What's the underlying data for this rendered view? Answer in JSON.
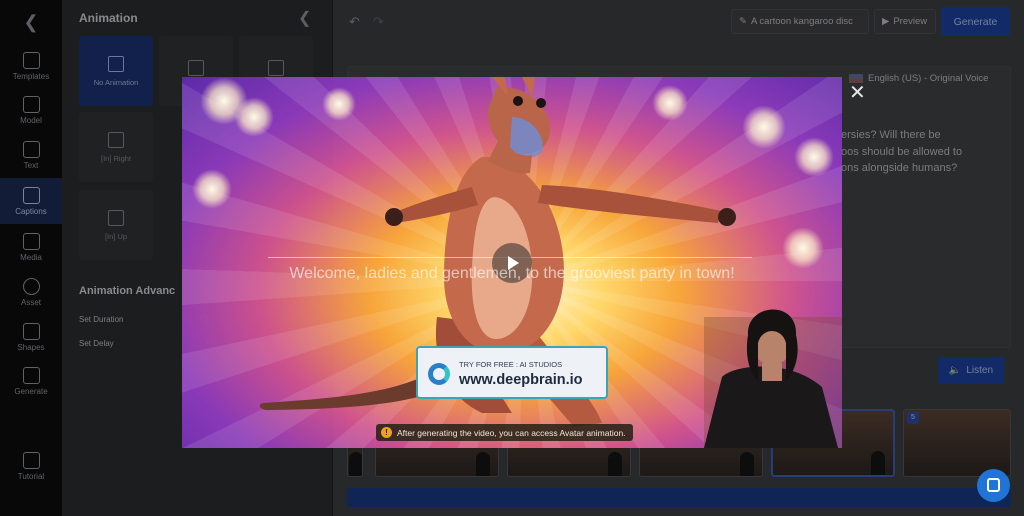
{
  "sidebar": {
    "back_icon": "chevron-left-icon",
    "items": [
      {
        "label": "Templates",
        "icon": "templates-icon"
      },
      {
        "label": "Model",
        "icon": "model-icon"
      },
      {
        "label": "Text",
        "icon": "text-icon"
      },
      {
        "label": "Captions",
        "icon": "captions-icon",
        "active": true
      },
      {
        "label": "Media",
        "icon": "media-icon"
      },
      {
        "label": "Asset",
        "icon": "asset-icon"
      },
      {
        "label": "Shapes",
        "icon": "shapes-icon"
      },
      {
        "label": "Generate",
        "icon": "generate-icon"
      },
      {
        "label": "Tutorial",
        "icon": "tutorial-icon"
      }
    ]
  },
  "panel": {
    "title": "Animation",
    "tiles": [
      {
        "label": "No Animation",
        "selected": true
      },
      {
        "label": ""
      },
      {
        "label": ""
      },
      {
        "label": "[In] Right"
      },
      {
        "label": "[In] Up"
      }
    ],
    "advanced_title": "Animation Advanc",
    "set_duration": "Set Duration",
    "set_delay": "Set Delay"
  },
  "toolbar": {
    "project_title": "A cartoon kangaroo disc",
    "preview_label": "Preview",
    "generate_label": "Generate"
  },
  "script": {
    "voice": "English (US) - Original Voice",
    "lines": [
      "ersies? Will there be",
      "oos should be allowed to",
      "ons alongside humans?"
    ],
    "listen_label": "Listen"
  },
  "scenes": {
    "selected_number": "5"
  },
  "modal": {
    "caption": "Welcome, ladies and gentlemen, to the grooviest party in town!",
    "watermark_small": "TRY FOR FREE : AI STUDIOS",
    "watermark_big": "www.deepbrain.io",
    "notice": "After generating the video, you can access Avatar animation."
  },
  "colors": {
    "accent": "#1b3f9a",
    "sidebar_bg": "#0c0c0e",
    "notice_icon": "#f0a21b",
    "chat": "#1f74d6"
  }
}
